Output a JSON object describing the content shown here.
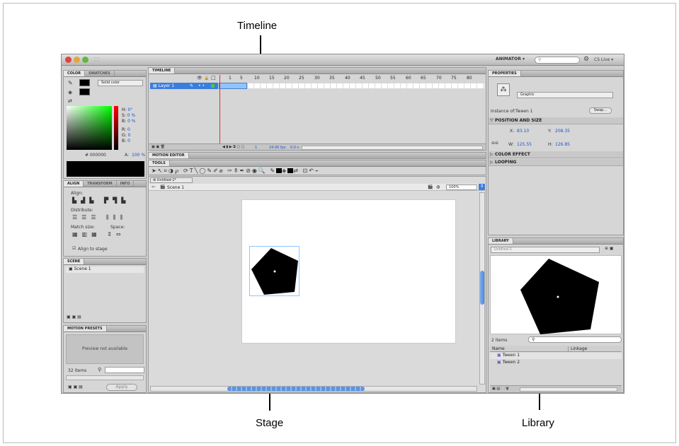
{
  "callouts": {
    "timeline": "Timeline",
    "stage": "Stage",
    "library": "Library"
  },
  "topbar": {
    "workspace": "ANIMATOR ▾",
    "search_placeholder": "",
    "cs_live": "CS Live ▾"
  },
  "color_panel": {
    "tabs": [
      "COLOR",
      "SWATCHES"
    ],
    "fill_type": "Solid color",
    "hsb": [
      {
        "k": "H:",
        "v": "0°"
      },
      {
        "k": "S:",
        "v": "0 %"
      },
      {
        "k": "B:",
        "v": "0 %"
      }
    ],
    "rgb": [
      {
        "k": "R:",
        "v": "0"
      },
      {
        "k": "G:",
        "v": "0"
      },
      {
        "k": "B:",
        "v": "0"
      }
    ],
    "hex": "# 000000",
    "alpha_label": "A:",
    "alpha": "100 %"
  },
  "align_panel": {
    "tabs": [
      "ALIGN",
      "TRANSFORM",
      "INFO"
    ],
    "align": "Align:",
    "distribute": "Distribute:",
    "match_size": "Match size:",
    "space": "Space:",
    "align_to_stage": "Align to stage"
  },
  "scene_panel": {
    "tab": "SCENE",
    "items": [
      "Scene 1"
    ]
  },
  "motion_presets": {
    "tab": "MOTION PRESETS",
    "preview": "Preview not available",
    "count": "32 items",
    "apply": "Apply"
  },
  "timeline": {
    "tab": "TIMELINE",
    "layer": "Layer 1",
    "frames": [
      "1",
      "5",
      "10",
      "15",
      "20",
      "25",
      "30",
      "35",
      "40",
      "45",
      "50",
      "55",
      "60",
      "65",
      "70",
      "75",
      "80"
    ],
    "fps": "24.00 fps",
    "time": "0.0 s",
    "frame_current": "1"
  },
  "motion_editor_tab": "MOTION EDITOR",
  "tools_tab": "TOOLS",
  "doc": {
    "tab": "Untitled-1*",
    "scene": "Scene 1",
    "zoom": "100%"
  },
  "properties": {
    "tab": "PROPERTIES",
    "symbol_type": "Graphic",
    "instance_of_label": "Instance of:",
    "instance_of": "Tween 1",
    "swap": "Swap...",
    "pos_section": "POSITION AND SIZE",
    "x_label": "X:",
    "x": "83.10",
    "y_label": "Y:",
    "y": "208.35",
    "w_label": "W:",
    "w": "125.55",
    "h_label": "H:",
    "h": "126.85",
    "color_effect": "COLOR EFFECT",
    "looping": "LOOPING"
  },
  "library": {
    "tab": "LIBRARY",
    "doc": "Untitled-1",
    "count": "2 items",
    "col_name": "Name",
    "col_linkage": "Linkage",
    "items": [
      "Tween 1",
      "Tween 2"
    ]
  },
  "colors": {
    "accent": "#3b7ddd",
    "playhead": "#e03030",
    "selection": "#8fc4ff"
  }
}
